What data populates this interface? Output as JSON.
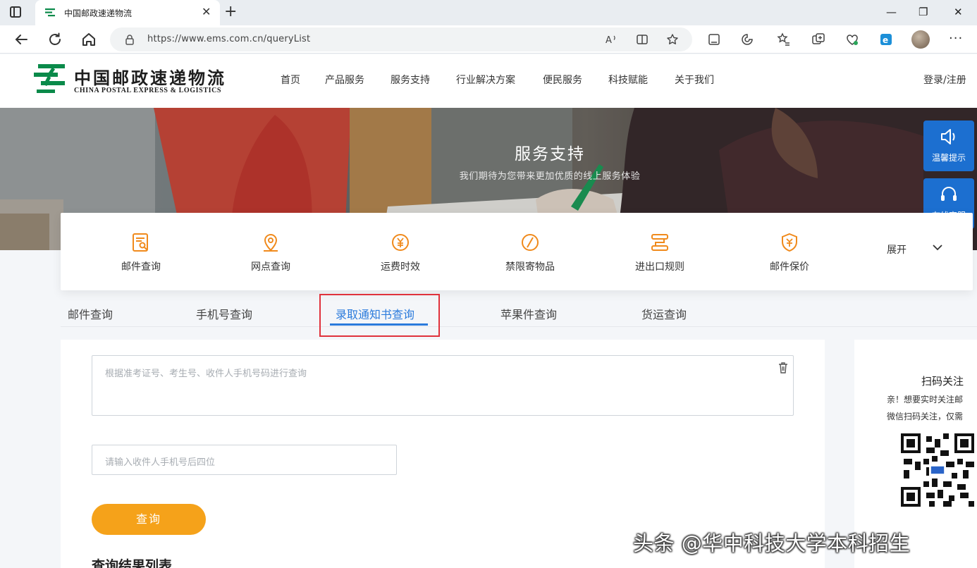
{
  "browser": {
    "tab_title": "中国邮政速递物流",
    "url": "https://www.ems.com.cn/queryList"
  },
  "site": {
    "logo_cn": "中国邮政速递物流",
    "logo_en": "CHINA POSTAL EXPRESS & LOGISTICS",
    "nav": [
      "首页",
      "产品服务",
      "服务支持",
      "行业解决方案",
      "便民服务",
      "科技赋能",
      "关于我们"
    ],
    "login": "登录/注册"
  },
  "banner": {
    "title": "服务支持",
    "subtitle": "我们期待为您带来更加优质的线上服务体验"
  },
  "side_buttons": {
    "tips": "温馨提示",
    "service": "在线客服"
  },
  "services": [
    {
      "label": "邮件查询",
      "icon": "document-search-icon"
    },
    {
      "label": "网点查询",
      "icon": "location-pin-icon"
    },
    {
      "label": "运费时效",
      "icon": "yuan-clock-icon"
    },
    {
      "label": "禁限寄物品",
      "icon": "prohibited-icon"
    },
    {
      "label": "进出口规则",
      "icon": "rules-icon"
    },
    {
      "label": "邮件保价",
      "icon": "shield-yuan-icon"
    }
  ],
  "expand_label": "展开",
  "tabs": [
    {
      "label": "邮件查询",
      "active": false
    },
    {
      "label": "手机号查询",
      "active": false
    },
    {
      "label": "录取通知书查询",
      "active": true
    },
    {
      "label": "苹果件查询",
      "active": false
    },
    {
      "label": "货运查询",
      "active": false
    }
  ],
  "form": {
    "main_placeholder": "根据准考证号、考生号、收件人手机号码进行查询",
    "phone_placeholder": "请输入收件人手机号后四位",
    "query_button": "查询",
    "result_title": "查询结果列表"
  },
  "qr_panel": {
    "title": "扫码关注",
    "line1": "亲！想要实时关注邮",
    "line2": "微信扫码关注，仅需"
  },
  "watermark": "头条 @华中科技大学本科招生",
  "colors": {
    "accent_blue": "#2b7bdc",
    "button_orange": "#f5a21a",
    "icon_orange": "#f08a1c",
    "highlight_red": "#e0323c",
    "logo_green": "#0a8a4a"
  }
}
